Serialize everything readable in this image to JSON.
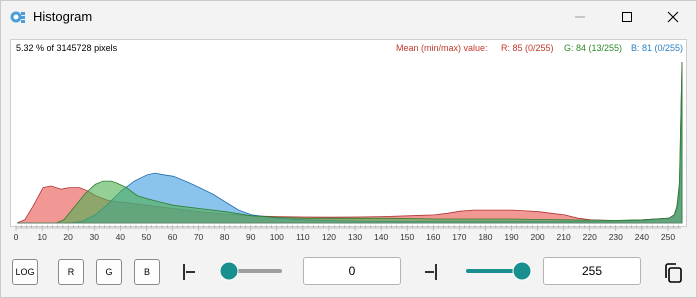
{
  "window": {
    "title": "Histogram",
    "app_icon": "histogram-app-icon",
    "controls": [
      "minimize-icon",
      "maximize-icon",
      "close-icon"
    ]
  },
  "info": {
    "pixels_text": "5.32 % of 3145728 pixels",
    "mean_label": "Mean (min/max) value:",
    "mean_r": "R: 85 (0/255)",
    "mean_g": "G: 84 (13/255)",
    "mean_b": "B: 81 (0/255)"
  },
  "colors": {
    "red": "#e8534f",
    "green": "#4caf50",
    "blue": "#3d9be0",
    "overlap": "#555555",
    "accent": "#1a8f8f"
  },
  "chart_data": {
    "type": "area",
    "x_ticks": [
      0,
      10,
      20,
      30,
      40,
      50,
      60,
      70,
      80,
      90,
      100,
      110,
      120,
      130,
      140,
      150,
      160,
      170,
      180,
      190,
      200,
      210,
      220,
      230,
      240,
      250
    ],
    "xlim": [
      0,
      255
    ],
    "ylim": [
      0,
      1
    ],
    "scale": "linear",
    "grid": false,
    "series": [
      {
        "name": "R",
        "x": [
          0,
          3,
          6,
          10,
          13,
          17,
          20,
          24,
          27,
          30,
          35,
          40,
          50,
          60,
          70,
          80,
          90,
          100,
          110,
          120,
          130,
          140,
          150,
          160,
          165,
          170,
          175,
          180,
          185,
          190,
          195,
          200,
          205,
          210,
          215,
          220,
          230,
          240,
          250,
          252,
          253,
          254,
          255
        ],
        "values": [
          0,
          0.02,
          0.1,
          0.22,
          0.23,
          0.21,
          0.22,
          0.22,
          0.2,
          0.17,
          0.14,
          0.13,
          0.11,
          0.09,
          0.07,
          0.055,
          0.045,
          0.04,
          0.037,
          0.036,
          0.037,
          0.04,
          0.045,
          0.05,
          0.06,
          0.073,
          0.08,
          0.08,
          0.08,
          0.08,
          0.075,
          0.07,
          0.06,
          0.05,
          0.03,
          0.02,
          0.015,
          0.02,
          0.03,
          0.05,
          0.1,
          0.2,
          1.0
        ]
      },
      {
        "name": "G",
        "x": [
          0,
          15,
          18,
          22,
          26,
          30,
          33,
          36,
          38,
          42,
          46,
          50,
          55,
          60,
          70,
          80,
          90,
          100,
          110,
          120,
          130,
          140,
          150,
          160,
          170,
          180,
          190,
          200,
          210,
          220,
          230,
          240,
          250,
          252,
          253,
          254,
          255
        ],
        "values": [
          0,
          0,
          0.02,
          0.1,
          0.18,
          0.24,
          0.26,
          0.26,
          0.25,
          0.22,
          0.17,
          0.15,
          0.13,
          0.11,
          0.09,
          0.07,
          0.045,
          0.035,
          0.03,
          0.03,
          0.03,
          0.03,
          0.028,
          0.025,
          0.025,
          0.025,
          0.025,
          0.022,
          0.02,
          0.018,
          0.016,
          0.02,
          0.03,
          0.05,
          0.1,
          0.25,
          1.0
        ]
      },
      {
        "name": "B",
        "x": [
          0,
          20,
          25,
          30,
          35,
          40,
          45,
          50,
          53,
          56,
          60,
          63,
          66,
          70,
          75,
          80,
          85,
          90,
          100,
          110,
          120,
          130,
          140,
          150,
          160,
          170,
          180,
          190,
          200,
          210,
          220,
          230,
          240,
          250,
          252,
          253,
          254,
          255
        ],
        "values": [
          0,
          0,
          0.01,
          0.05,
          0.12,
          0.2,
          0.26,
          0.3,
          0.31,
          0.3,
          0.29,
          0.27,
          0.25,
          0.22,
          0.18,
          0.13,
          0.08,
          0.05,
          0.03,
          0.02,
          0.015,
          0.012,
          0.01,
          0.01,
          0.01,
          0.01,
          0.01,
          0.01,
          0.01,
          0.01,
          0.01,
          0.012,
          0.015,
          0.03,
          0.05,
          0.08,
          0.15,
          0.9
        ]
      }
    ]
  },
  "controls": {
    "log_label": "LOG",
    "r_label": "R",
    "g_label": "G",
    "b_label": "B",
    "min_value": "0",
    "max_value": "255",
    "min_slider_fraction": 0.0,
    "max_slider_fraction": 1.0
  },
  "icons": {
    "min_bracket": "range-min-icon",
    "max_bracket": "range-max-icon",
    "copy": "copy-icon"
  }
}
